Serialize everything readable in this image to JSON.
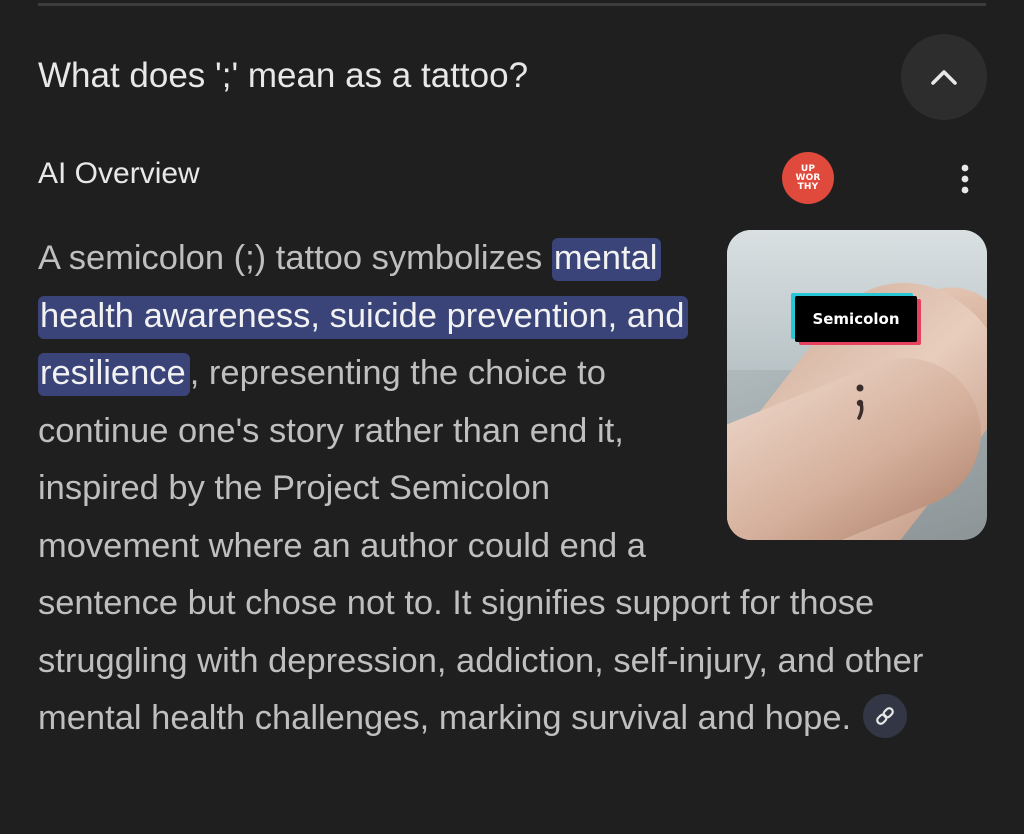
{
  "header": {
    "question": "What does ';' mean as a tattoo?",
    "collapse_icon": "chevron-up-icon"
  },
  "overview": {
    "label": "AI Overview",
    "source_logo_lines": [
      "UP",
      "WOR",
      "THY"
    ],
    "source_logo_color": "#e04a3c",
    "more_icon": "more-vert-icon"
  },
  "answer": {
    "text_before": "A semicolon (;) tattoo symbolizes ",
    "highlighted": "mental health awareness, suicide prevention, and resilience",
    "text_after": ", representing the choice to continue one's story rather than end it, inspired by the Project Semicolon movement where an author could end a sentence but chose not to. It signifies support for those struggling with depression, addiction, self-injury, and other mental health challenges, marking survival and hope.",
    "highlight_color": "#3a4479",
    "link_icon": "link-icon"
  },
  "thumbnail": {
    "tag_text": "Semicolon"
  },
  "colors": {
    "background": "#1f1f1f",
    "body_text": "#bfbfbf",
    "heading_text": "#e8e8e8"
  }
}
